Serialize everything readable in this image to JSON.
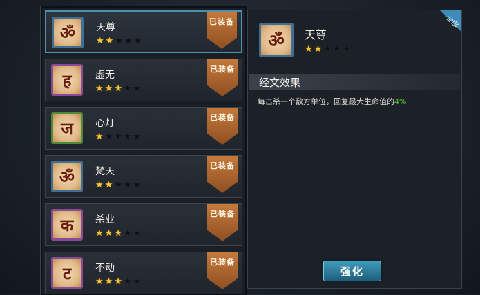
{
  "scriptures": [
    {
      "name": "天尊",
      "glyph": "ॐ",
      "frame": "blue",
      "stars": 2,
      "badge": "已装备",
      "selected": true
    },
    {
      "name": "虚无",
      "glyph": "ह",
      "frame": "purple",
      "stars": 3,
      "badge": "已装备",
      "selected": false
    },
    {
      "name": "心灯",
      "glyph": "ज",
      "frame": "green",
      "stars": 1,
      "badge": "已装备",
      "selected": false
    },
    {
      "name": "梵天",
      "glyph": "ॐ",
      "frame": "blue",
      "stars": 2,
      "badge": "已装备",
      "selected": false
    },
    {
      "name": "杀业",
      "glyph": "क",
      "frame": "purple",
      "stars": 3,
      "badge": "已装备",
      "selected": false
    },
    {
      "name": "不动",
      "glyph": "ट",
      "frame": "purple",
      "stars": 3,
      "badge": "已装备",
      "selected": false
    }
  ],
  "max_stars": 5,
  "detail": {
    "name": "天尊",
    "glyph": "ॐ",
    "stars": 2,
    "section_title": "经文效果",
    "effect_text": "每击杀一个敌方单位，回复最大生命值的",
    "effect_value": "4%",
    "corner_label": "全部"
  },
  "enhance_button": "强化",
  "colors": {
    "star_on": "#f2c53a",
    "highlight": "#58c23a",
    "accent": "#4f8fb0"
  }
}
